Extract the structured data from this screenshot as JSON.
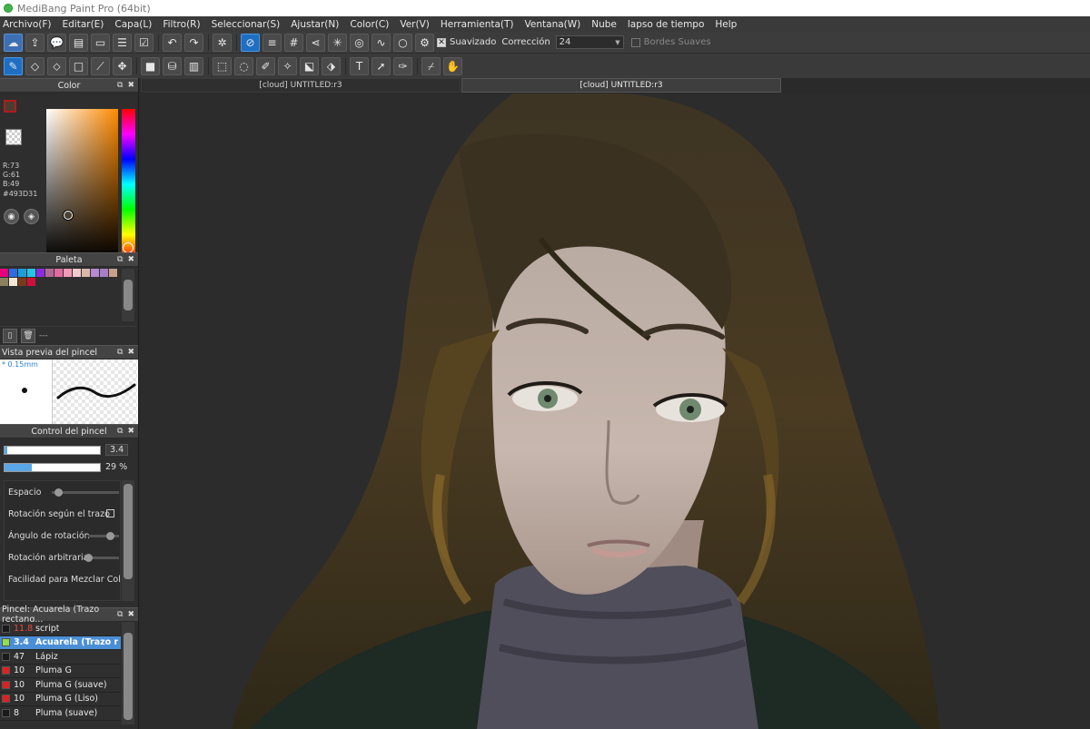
{
  "window": {
    "title": "MediBang Paint Pro (64bit)"
  },
  "menu": [
    "Archivo(F)",
    "Editar(E)",
    "Capa(L)",
    "Filtro(R)",
    "Seleccionar(S)",
    "Ajustar(N)",
    "Color(C)",
    "Ver(V)",
    "Herramienta(T)",
    "Ventana(W)",
    "Nube",
    "lapso de tiempo",
    "Help"
  ],
  "toolbar": {
    "smoothing_label": "Suavizado",
    "correction_label": "Corrección",
    "correction_value": "24",
    "soft_edges_label": "Bordes Suaves"
  },
  "panels": {
    "color": {
      "title": "Color",
      "r": "R:73",
      "g": "G:61",
      "b": "B:49",
      "hex": "#493D31",
      "fg_color": "#493d31"
    },
    "palette": {
      "title": "Paleta",
      "swatches": [
        "#e6007a",
        "#2d6cdf",
        "#1e9dd8",
        "#27c3e6",
        "#8a2be2",
        "#b06a95",
        "#e06aa0",
        "#f09ab5",
        "#f5c8cf",
        "#d9b8a8",
        "#b58ad3",
        "#a77fc6",
        "#c7a08a",
        "#8a7f5f",
        "#f2e8d5",
        "#7a3a1e",
        "#d10f3c"
      ],
      "footer_text": "---"
    },
    "brush_preview": {
      "title": "Vista previa del pincel",
      "size": "* 0.15mm"
    },
    "brush_control": {
      "title": "Control del pincel",
      "size_value": "3.4",
      "opacity_value": "29 %",
      "opacity_fraction": 0.29,
      "size_fraction": 0.03,
      "rows": [
        "Espacio",
        "Rotación según el trazo",
        "Ángulo de rotación",
        "Rotación arbitraria",
        "Facilidad para Mezclar Colores"
      ]
    },
    "brush_list": {
      "title": "Pincel: Acuarela (Trazo rectang...",
      "items": [
        {
          "size": "11.8",
          "name": "script",
          "color": "#1a1a1a",
          "size_color": "#e74c3c"
        },
        {
          "size": "3.4",
          "name": "Acuarela (Trazo r",
          "color": "#8ee04e",
          "size_color": "#ff6b6b",
          "selected": true
        },
        {
          "size": "47",
          "name": "Lápiz",
          "color": "#1a1a1a",
          "size_color": "#eaeaea"
        },
        {
          "size": "10",
          "name": "Pluma G",
          "color": "#e02020",
          "size_color": "#eaeaea"
        },
        {
          "size": "10",
          "name": "Pluma G (suave)",
          "color": "#e02020",
          "size_color": "#eaeaea"
        },
        {
          "size": "10",
          "name": "Pluma G (Liso)",
          "color": "#e02020",
          "size_color": "#eaeaea"
        },
        {
          "size": "8",
          "name": "Pluma (suave)",
          "color": "#1a1a1a",
          "size_color": "#eaeaea"
        }
      ]
    }
  },
  "tabs": [
    "[cloud] UNTITLED:r3",
    "[cloud] UNTITLED:r3"
  ],
  "colors": {
    "accent": "#1e6fc2",
    "selection": "#4a8fd6",
    "canvas_bg": "#2c2c2c"
  }
}
